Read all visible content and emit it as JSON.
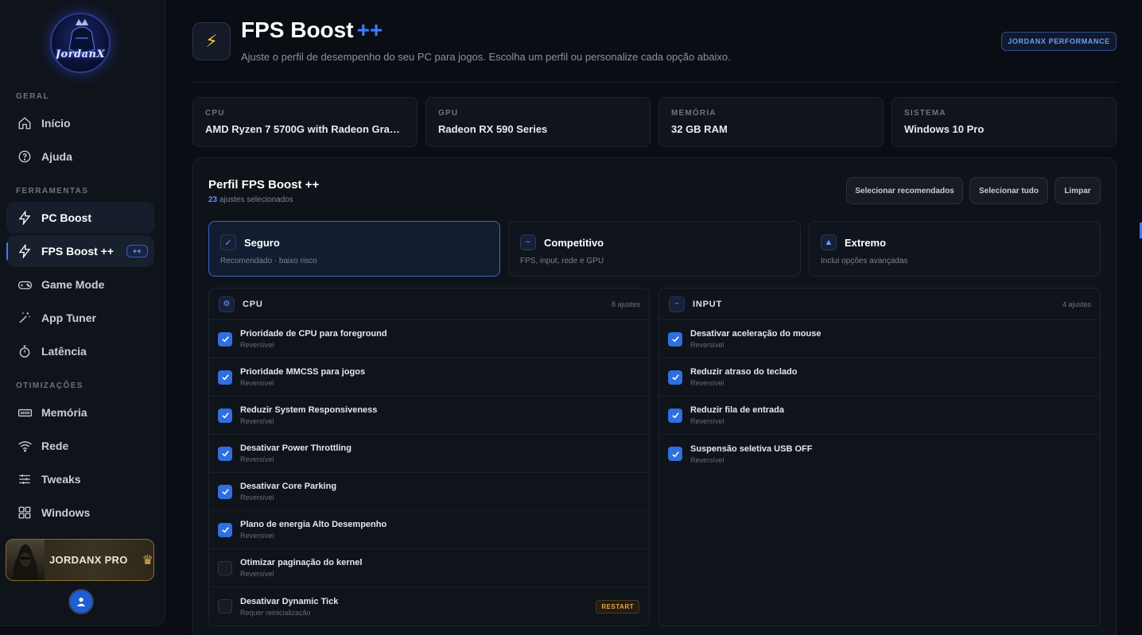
{
  "sidebar": {
    "logo_text": "JordanX",
    "sections": {
      "geral": "GERAL",
      "ferramentas": "FERRAMENTAS",
      "otimizacoes": "OTIMIZAÇÕES"
    },
    "items": {
      "inicio": "Início",
      "ajuda": "Ajuda",
      "pc_boost": "PC Boost",
      "fps_boost": "FPS Boost ++",
      "fps_badge": "++",
      "game_mode": "Game Mode",
      "app_tuner": "App Tuner",
      "latencia": "Latência",
      "memoria": "Memória",
      "rede": "Rede",
      "tweaks": "Tweaks",
      "windows": "Windows"
    },
    "pro_label": "JORDANX PRO"
  },
  "header": {
    "title": "FPS Boost",
    "title_suffix": "++",
    "subtitle": "Ajuste o perfil de desempenho do seu PC para jogos. Escolha um perfil ou personalize cada opção abaixo.",
    "brand_badge": "JORDANX PERFORMANCE"
  },
  "specs": [
    {
      "key": "CPU",
      "value": "AMD Ryzen 7 5700G with Radeon Graphics"
    },
    {
      "key": "GPU",
      "value": "Radeon RX 590 Series"
    },
    {
      "key": "MEMÓRIA",
      "value": "32 GB RAM"
    },
    {
      "key": "SISTEMA",
      "value": "Windows 10 Pro"
    }
  ],
  "profile": {
    "title": "Perfil FPS Boost ++",
    "count": "23",
    "count_suffix": "ajustes selecionados",
    "buttons": {
      "recommended": "Selecionar recomendados",
      "all": "Selecionar tudo",
      "clear": "Limpar"
    }
  },
  "modes": [
    {
      "title": "Seguro",
      "desc": "Recomendado · baixo risco",
      "selected": true
    },
    {
      "title": "Competitivo",
      "desc": "FPS, input, rede e GPU",
      "selected": false
    },
    {
      "title": "Extremo",
      "desc": "Inclui opções avançadas",
      "selected": false
    }
  ],
  "cpu": {
    "title": "CPU",
    "count": "8 ajustes",
    "rows": [
      {
        "title": "Prioridade de CPU para foreground",
        "sub": "Reversível",
        "checked": true
      },
      {
        "title": "Prioridade MMCSS para jogos",
        "sub": "Reversível",
        "checked": true
      },
      {
        "title": "Reduzir System Responsiveness",
        "sub": "Reversível",
        "checked": true
      },
      {
        "title": "Desativar Power Throttling",
        "sub": "Reversível",
        "checked": true
      },
      {
        "title": "Desativar Core Parking",
        "sub": "Reversível",
        "checked": true
      },
      {
        "title": "Plano de energia Alto Desempenho",
        "sub": "Reversível",
        "checked": true
      },
      {
        "title": "Otimizar paginação do kernel",
        "sub": "Reversível",
        "checked": false
      },
      {
        "title": "Desativar Dynamic Tick",
        "sub": "Requer reinicialização",
        "checked": false,
        "tag": "RESTART"
      }
    ]
  },
  "input": {
    "title": "INPUT",
    "count": "4 ajustes",
    "rows": [
      {
        "title": "Desativar aceleração do mouse",
        "sub": "Reversível",
        "checked": true
      },
      {
        "title": "Reduzir atraso do teclado",
        "sub": "Reversível",
        "checked": true
      },
      {
        "title": "Reduzir fila de entrada",
        "sub": "Reversível",
        "checked": true
      },
      {
        "title": "Suspensão seletiva USB OFF",
        "sub": "Reversível",
        "checked": true
      }
    ]
  },
  "colors": {
    "accent": "#3d7bff",
    "bg": "#0a0d13",
    "gold": "#e3b552"
  }
}
